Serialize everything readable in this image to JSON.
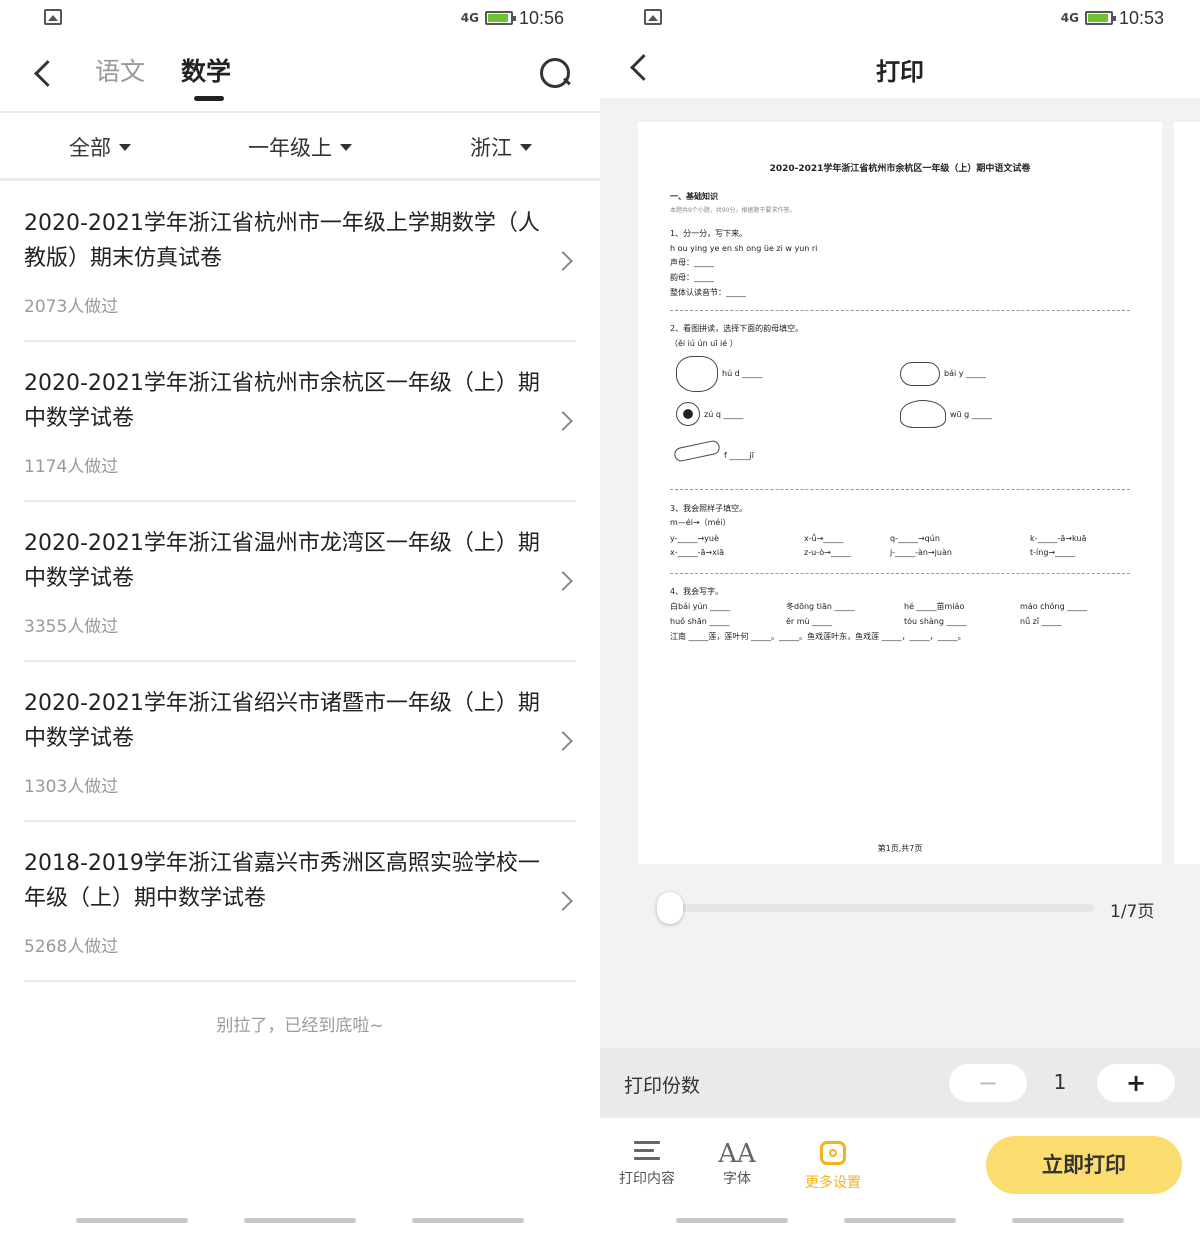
{
  "left": {
    "status": {
      "time": "10:56",
      "network": "4G"
    },
    "tabs": [
      {
        "label": "语文",
        "active": false
      },
      {
        "label": "数学",
        "active": true
      }
    ],
    "filters": [
      {
        "label": "全部"
      },
      {
        "label": "一年级上"
      },
      {
        "label": "浙江"
      }
    ],
    "items": [
      {
        "title": "2020-2021学年浙江省杭州市一年级上学期数学（人教版）期末仿真试卷",
        "count": "2073人做过"
      },
      {
        "title": "2020-2021学年浙江省杭州市余杭区一年级（上）期中数学试卷",
        "count": "1174人做过"
      },
      {
        "title": "2020-2021学年浙江省温州市龙湾区一年级（上）期中数学试卷",
        "count": "3355人做过"
      },
      {
        "title": "2020-2021学年浙江省绍兴市诸暨市一年级（上）期中数学试卷",
        "count": "1303人做过"
      },
      {
        "title": "2018-2019学年浙江省嘉兴市秀洲区高照实验学校一年级（上）期中数学试卷",
        "count": "5268人做过"
      }
    ],
    "end_text": "别拉了，已经到底啦~"
  },
  "right": {
    "status": {
      "time": "10:53",
      "network": "4G"
    },
    "title": "打印",
    "doc": {
      "title": "2020-2021学年浙江省杭州市余杭区一年级（上）期中语文试卷",
      "section": "一、基础知识",
      "section_note": "本题共9个小题，共90分。根据题干要求作答。",
      "q1": "1、分一分，写下来。",
      "q1_line": "h  ou  ying  ye  en  sh  ong  üe  zi  w  yun  ri",
      "q1_a": "声母：_____",
      "q1_b": "韵母：_____",
      "q1_c": "整体认读音节：_____",
      "q2": "2、看图拼读，选择下面的韵母填空。",
      "q2_opts": "（ěi   iú   ún   uī   ié ）",
      "q2_a": "hú d _____",
      "q2_b": "bái y _____",
      "q2_c": "zú q _____",
      "q2_d": "wū g _____",
      "q2_e": "f _____jī",
      "q3": "3、我会照样子填空。",
      "q3_ex": "m—éi→（méi）",
      "q3_r1": [
        "y-_____→yuè",
        "x-ǚ→_____",
        "q-_____→qún",
        "k-_____-ā→kuā"
      ],
      "q3_r2": [
        "x-_____-ā→xiā",
        "z-u-ò→_____",
        "j-_____-àn→juàn",
        "t-íng→_____"
      ],
      "q4": "4、我会写字。",
      "q4_r1": [
        "白bái yún _____",
        "冬dōng tiān _____",
        "hé _____苗miáo",
        "máo chóng _____"
      ],
      "q4_r2": [
        "huǒ shān _____",
        "ěr mù _____",
        "tóu shàng _____",
        "nǚ zǐ _____"
      ],
      "q4_r3": "江南 _____莲，莲叶何 _____。_____。鱼戏莲叶东，鱼戏莲 _____，_____，_____。",
      "footer": "第1页,共7页"
    },
    "page_indicator": "1/7页",
    "page_progress": 0.0,
    "copies_label": "打印份数",
    "copies_value": "1",
    "minus_label": "−",
    "plus_label": "+",
    "tools": [
      {
        "label": "打印内容"
      },
      {
        "label": "字体",
        "icon_text": "AA"
      },
      {
        "label": "更多设置",
        "active": true
      }
    ],
    "print_button": "立即打印"
  },
  "colors": {
    "accent": "#fadd6e",
    "accent_text": "#f2b31d",
    "muted": "#9a9a9a"
  }
}
